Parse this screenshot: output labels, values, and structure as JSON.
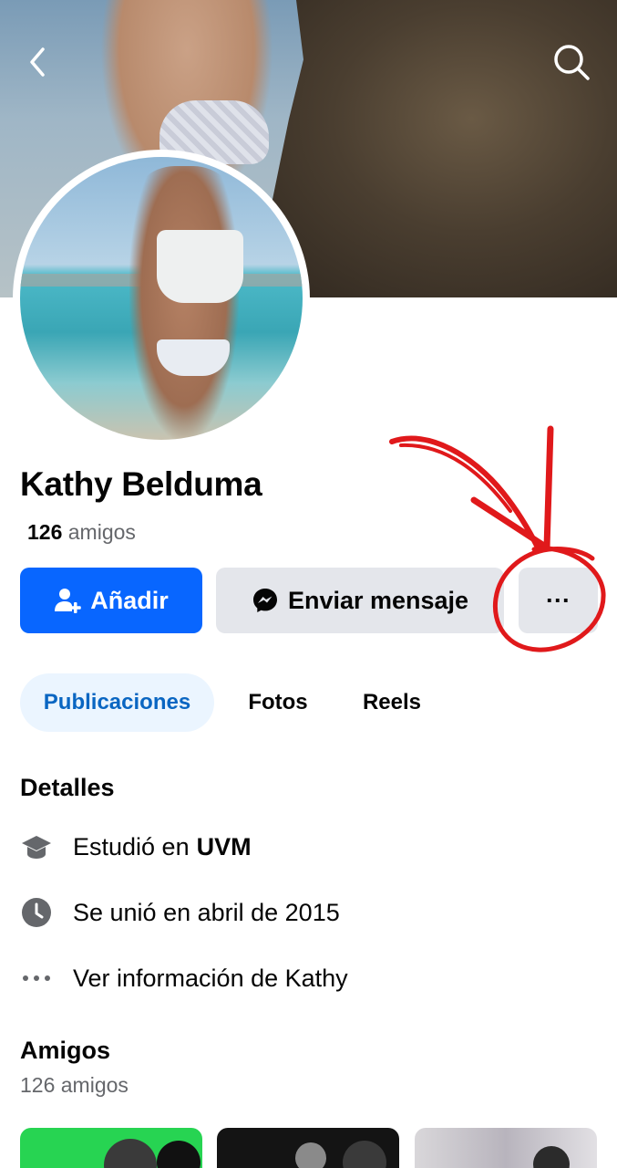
{
  "profile": {
    "name": "Kathy Belduma",
    "friends_count": "126",
    "friends_word": "amigos"
  },
  "actions": {
    "add_label": "Añadir",
    "message_label": "Enviar mensaje",
    "more_label": "···"
  },
  "tabs": [
    {
      "label": "Publicaciones",
      "active": true
    },
    {
      "label": "Fotos",
      "active": false
    },
    {
      "label": "Reels",
      "active": false
    }
  ],
  "details": {
    "title": "Detalles",
    "education_prefix": "Estudió en",
    "education_school": "UVM",
    "joined": "Se unió en abril de 2015",
    "more_info": "Ver información de Kathy"
  },
  "friends_section": {
    "title": "Amigos",
    "subtitle": "126 amigos"
  },
  "colors": {
    "primary": "#0866ff",
    "secondary_button": "#e4e6eb",
    "active_tab_bg": "#ebf5ff",
    "active_tab_text": "#0a66c2",
    "annotation": "#e0191b"
  },
  "icons": {
    "back": "chevron-left-icon",
    "search": "search-icon",
    "add_friend": "add-friend-icon",
    "messenger": "messenger-icon",
    "education": "graduation-cap-icon",
    "clock": "clock-icon",
    "dots": "dots-icon"
  }
}
